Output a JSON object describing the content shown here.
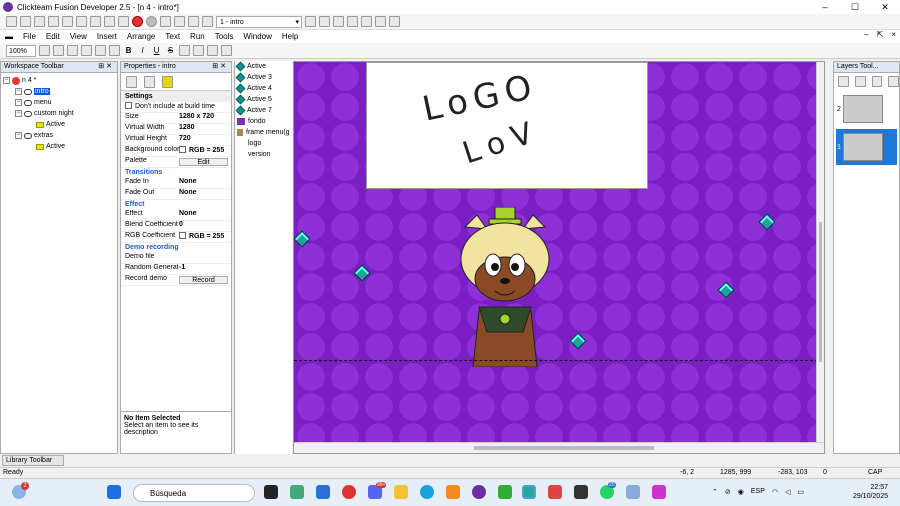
{
  "window": {
    "title": "Clickteam Fusion Developer 2.5 - [n 4 - intro*]",
    "min": "–",
    "max": "☐",
    "close": "✕"
  },
  "toolbar1": {
    "frame_select": "1 - intro"
  },
  "menu": {
    "items": [
      "File",
      "Edit",
      "View",
      "Insert",
      "Arrange",
      "Text",
      "Run",
      "Tools",
      "Window",
      "Help"
    ],
    "mdi": [
      "–",
      "⇱",
      "×"
    ]
  },
  "toolbar2": {
    "zoom": "100%",
    "bold": "B",
    "italic": "I",
    "underline": "U",
    "strike": "S"
  },
  "workspace": {
    "title": "Workspace Toolbar",
    "tree": [
      {
        "label": "n 4 *",
        "depth": 0,
        "type": "app"
      },
      {
        "label": "intro",
        "depth": 1,
        "type": "frame",
        "selected": true
      },
      {
        "label": "menu",
        "depth": 1,
        "type": "frame"
      },
      {
        "label": "custom night",
        "depth": 1,
        "type": "frame"
      },
      {
        "label": "Active",
        "depth": 2,
        "type": "active"
      },
      {
        "label": "extras",
        "depth": 1,
        "type": "frame"
      },
      {
        "label": "Active",
        "depth": 2,
        "type": "active"
      }
    ],
    "library_tab": "Library Toolbar"
  },
  "properties": {
    "title": "Properties - intro",
    "section": "Settings",
    "rows": [
      {
        "type": "check",
        "k": "Don't include at build time"
      },
      {
        "k": "Size",
        "v": "1280 x 720"
      },
      {
        "k": "Virtual Width",
        "v": "1280"
      },
      {
        "k": "Virtual Height",
        "v": "720"
      },
      {
        "k": "Background color",
        "v": "RGB = 255"
      },
      {
        "k": "Palette",
        "btn": "Edit"
      },
      {
        "type": "cat",
        "k": "Transitions"
      },
      {
        "k": "Fade In",
        "v": "None"
      },
      {
        "k": "Fade Out",
        "v": "None"
      },
      {
        "type": "cat",
        "k": "Effect"
      },
      {
        "k": "Effect",
        "v": "None"
      },
      {
        "k": "Blend Coefficient",
        "v": "0"
      },
      {
        "k": "RGB Coefficient",
        "v": "RGB = 255"
      },
      {
        "type": "cat",
        "k": "Demo recording"
      },
      {
        "k": "Demo file",
        "v": ""
      },
      {
        "k": "Random Generator",
        "v": "-1"
      },
      {
        "k": "Record demo",
        "btn": "Record"
      }
    ],
    "desc_title": "No Item Selected",
    "desc_text": "Select an item to see its description"
  },
  "objects": [
    {
      "label": "Active",
      "icon": "gem"
    },
    {
      "label": "Active 3",
      "icon": "gem"
    },
    {
      "label": "Active 4",
      "icon": "gem"
    },
    {
      "label": "Active 5",
      "icon": "gem"
    },
    {
      "label": "Active 7",
      "icon": "gem"
    },
    {
      "label": "fondo",
      "icon": "purple"
    },
    {
      "label": "frame menu(g",
      "icon": "frame"
    },
    {
      "label": "logo",
      "icon": "none"
    },
    {
      "label": "version",
      "icon": "none"
    }
  ],
  "layers": {
    "title": "Layers Tool...",
    "items": [
      {
        "n": "2"
      },
      {
        "n": "1",
        "selected": true
      }
    ]
  },
  "status": {
    "text": "Ready",
    "coords": "-6, 2",
    "size": "1285, 999",
    "pos": "-283, 103",
    "zero": "0",
    "caps": "CAP NUM"
  },
  "taskbar": {
    "search": "Búsqueda",
    "lang": "ESP",
    "time": "22:57",
    "date": "29/10/2025",
    "weather_badge": "2",
    "badge1": "99+",
    "badge2": "20"
  }
}
